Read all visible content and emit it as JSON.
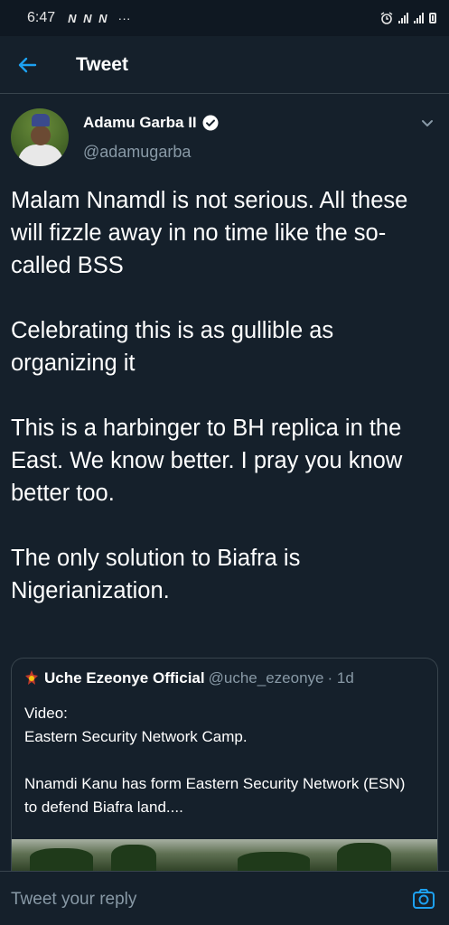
{
  "status_bar": {
    "time": "6:47",
    "notifications": "N N N",
    "more": "···"
  },
  "header": {
    "title": "Tweet"
  },
  "author": {
    "name": "Adamu Garba II",
    "handle": "@adamugarba"
  },
  "tweet": {
    "paragraphs": [
      "Malam Nnamdl is not serious. All these will fizzle away in no time like the so-called BSS",
      "Celebrating this is as gullible as organizing it",
      "This is a harbinger to BH replica in the East. We know better. I pray you know better too.",
      "The only solution to Biafra is Nigerianization."
    ]
  },
  "quote": {
    "name": "Uche Ezeonye Official",
    "handle": "@uche_ezeonye",
    "time": "· 1d",
    "lines": [
      "Video:",
      "Eastern Security Network Camp."
    ],
    "paragraph2": "Nnamdi Kanu has form Eastern Security Network (ESN) to defend Biafra land...."
  },
  "reply": {
    "placeholder": "Tweet your reply"
  },
  "colors": {
    "background": "#15202b",
    "accent": "#1da1f2",
    "secondary_text": "#8899a6",
    "divider": "#38444d"
  },
  "icons": [
    "back-arrow-icon",
    "verified-badge-icon",
    "chevron-down-icon",
    "camera-icon",
    "alarm-icon",
    "signal-icon",
    "battery-icon"
  ]
}
